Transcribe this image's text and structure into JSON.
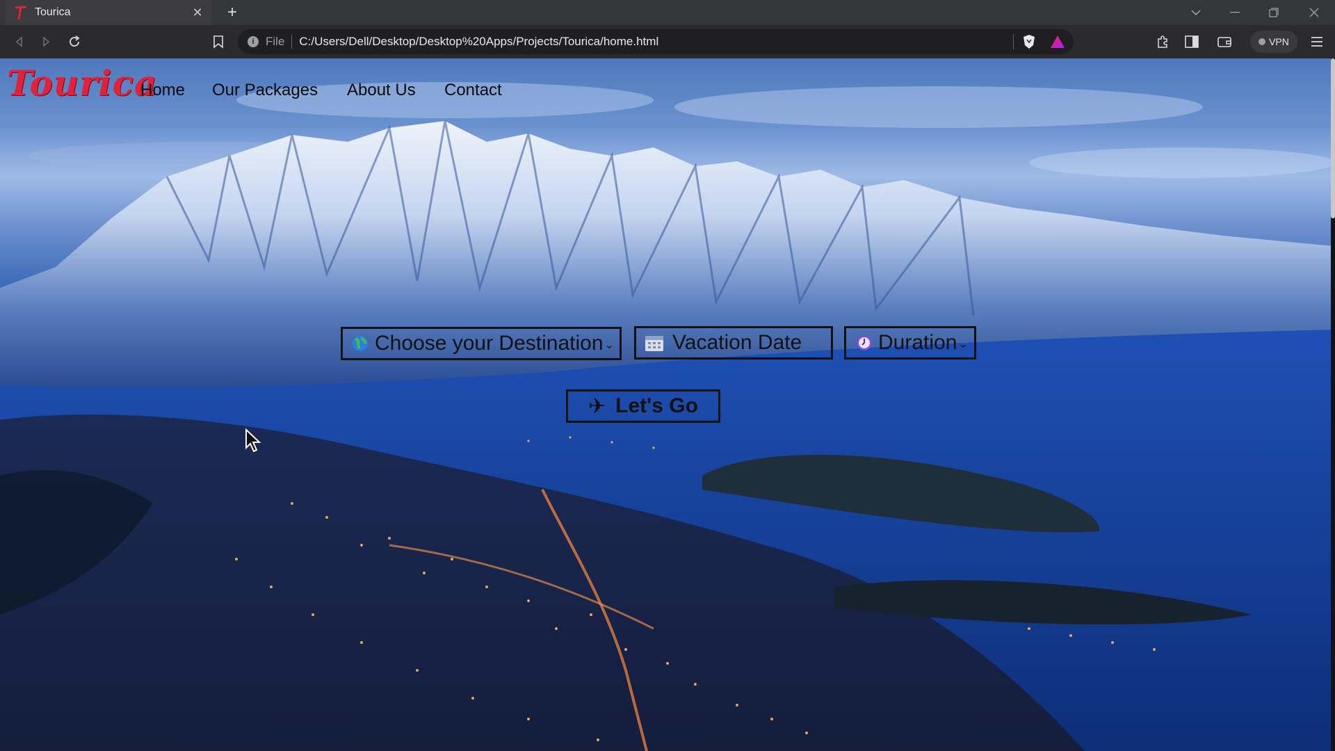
{
  "browser": {
    "tab_title": "Tourica",
    "tab_close": "✕",
    "new_tab": "+",
    "url_scheme": "File",
    "url": "C:/Users/Dell/Desktop/Desktop%20Apps/Projects/Tourica/home.html",
    "vpn_label": "VPN"
  },
  "site": {
    "logo": "Tourica",
    "nav": {
      "home": "Home",
      "packages": "Our Packages",
      "about": "About Us",
      "contact": "Contact"
    },
    "search": {
      "destination": "Choose your Destination",
      "date": "Vacation Date",
      "duration": "Duration",
      "caret": "⌄",
      "go_label": "Let's Go",
      "go_icon": "✈"
    }
  },
  "colors": {
    "logo": "#e0223a",
    "border": "#111111"
  },
  "icons": [
    "tourica-favicon-icon",
    "back-icon",
    "forward-icon",
    "reload-icon",
    "bookmark-icon",
    "info-icon",
    "brave-shield-icon",
    "brave-rewards-icon",
    "extensions-icon",
    "sidebar-icon",
    "wallet-icon",
    "menu-icon",
    "globe-icon",
    "calendar-icon",
    "clock-icon",
    "airplane-icon",
    "mouse-cursor-icon"
  ]
}
